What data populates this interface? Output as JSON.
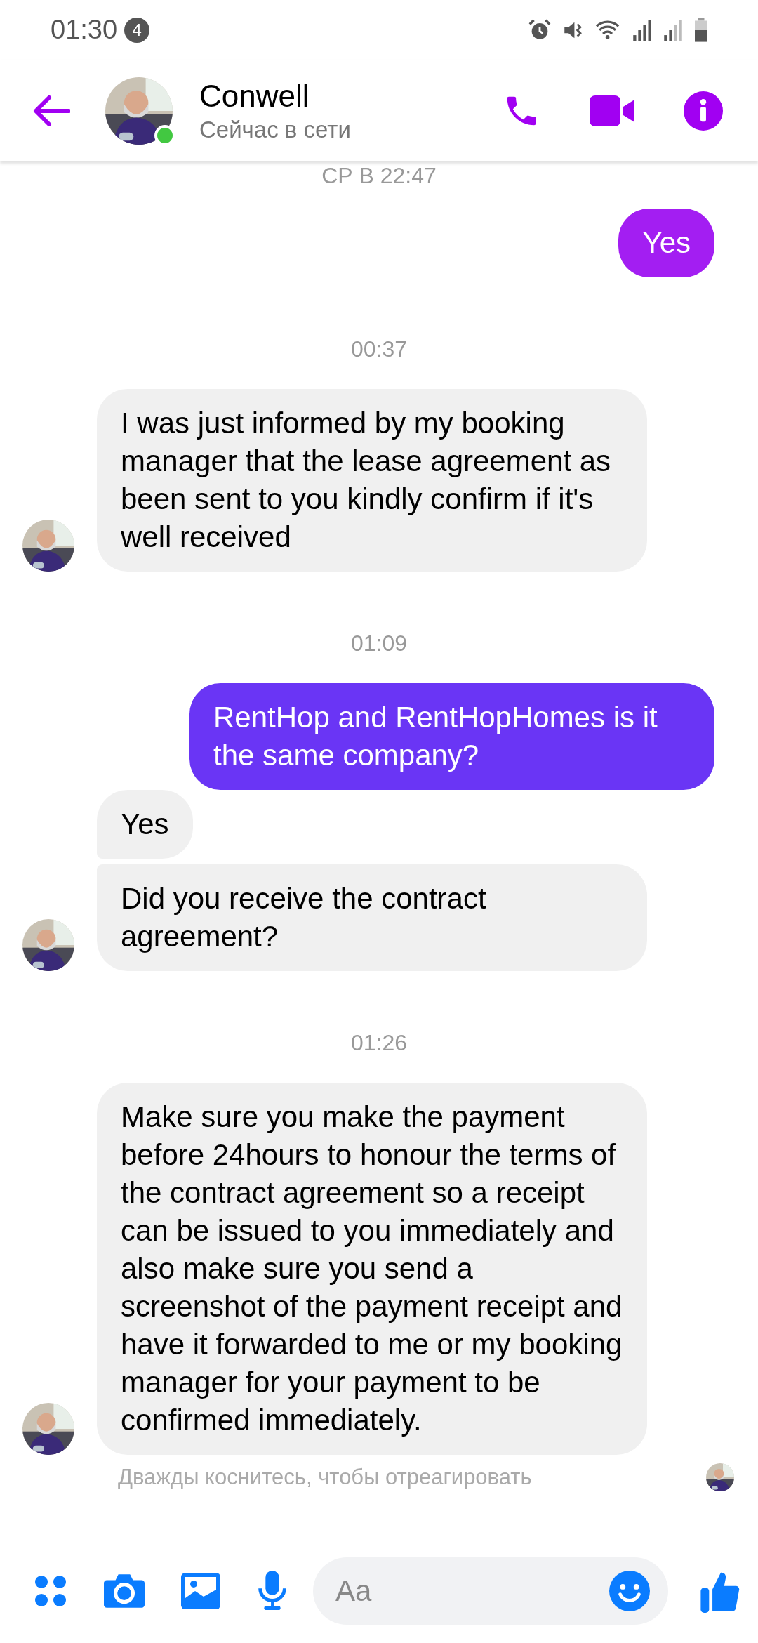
{
  "status_bar": {
    "time": "01:30",
    "notification_count": "4"
  },
  "header": {
    "name": "Conwell",
    "status": "Сейчас в сети",
    "online": true
  },
  "messages": [
    {
      "kind": "time",
      "text": "СР В 22:47"
    },
    {
      "kind": "out",
      "text": "Yes",
      "color": "#a31ef2"
    },
    {
      "kind": "time",
      "text": "00:37"
    },
    {
      "kind": "in",
      "text": "I was just informed by my booking manager that the lease agreement as been sent to you kindly confirm if it's well received",
      "avatar": true
    },
    {
      "kind": "time",
      "text": "01:09"
    },
    {
      "kind": "out",
      "text": "RentHop and RentHopHomes is it the same company?",
      "color": "#6a35f5"
    },
    {
      "kind": "in",
      "text": "Yes",
      "avatar": false
    },
    {
      "kind": "in",
      "text": "Did you receive the contract agreement?",
      "avatar": true
    },
    {
      "kind": "time",
      "text": "01:26"
    },
    {
      "kind": "in",
      "text": "Make sure you make the payment before 24hours to honour the terms of the contract agreement so a receipt can be issued to you immediately and also make sure you send a screenshot of the payment receipt and have it forwarded to me or my booking manager for your payment to be confirmed immediately.",
      "avatar": true
    }
  ],
  "reaction_hint": "Дважды коснитесь, чтобы отреагировать",
  "seen": true,
  "composer": {
    "placeholder": "Aa"
  }
}
